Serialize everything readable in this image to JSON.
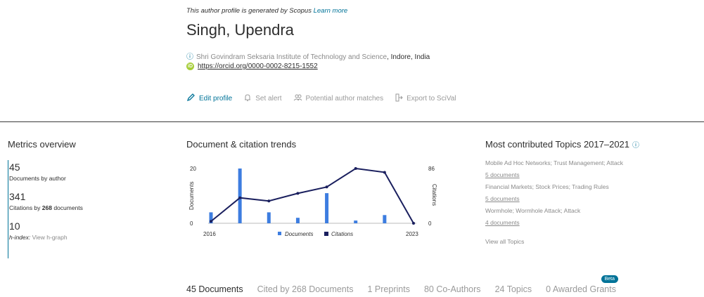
{
  "header": {
    "generated_text": "This author profile is generated by Scopus",
    "learn_more": "Learn more",
    "author_name": "Singh, Upendra",
    "institution": "Shri Govindram Seksaria Institute of Technology and Science",
    "location": ", Indore, India",
    "orcid_badge": "iD",
    "orcid_url": "https://orcid.org/0000-0002-8215-1552",
    "info_icon": "info-icon"
  },
  "actions": {
    "edit_profile": "Edit profile",
    "set_alert": "Set alert",
    "potential_matches": "Potential author matches",
    "export": "Export to SciVal"
  },
  "metrics": {
    "title": "Metrics overview",
    "documents_value": "45",
    "documents_label": "Documents by author",
    "citations_value": "341",
    "citations_label_pre": "Citations by ",
    "citations_docs": "268",
    "citations_label_post": " documents",
    "hindex_value": "10",
    "hindex_label": "h-index:",
    "hindex_link": "View h-graph"
  },
  "trends": {
    "title": "Document & citation trends"
  },
  "chart_data": {
    "type": "bar",
    "title": "Document & citation trends",
    "x": [
      2016,
      2017,
      2018,
      2019,
      2020,
      2021,
      2022,
      2023
    ],
    "x_tick_labels": [
      "2016",
      "2023"
    ],
    "ylabel_left": "Documents",
    "ylabel_right": "Citations",
    "ylim_left": [
      0,
      20
    ],
    "ylim_right": [
      0,
      86
    ],
    "left_ticks": [
      "20",
      "0"
    ],
    "right_ticks": [
      "86",
      "0"
    ],
    "series": [
      {
        "name": "Documents",
        "type": "bar",
        "axis": "left",
        "color": "#3d7de0",
        "values": [
          4,
          20,
          4,
          2,
          11,
          1,
          3,
          0
        ]
      },
      {
        "name": "Citations",
        "type": "line",
        "axis": "right",
        "color": "#1a1f5e",
        "values": [
          3,
          40,
          35,
          47,
          57,
          86,
          80,
          0
        ]
      }
    ],
    "legend_placement": "bottom"
  },
  "topics": {
    "title": "Most contributed Topics 2017–2021",
    "items": [
      {
        "name": "Mobile Ad Hoc Networks; Trust Management; Attack",
        "count": "5 documents"
      },
      {
        "name": "Financial Markets; Stock Prices; Trading Rules",
        "count": "5 documents"
      },
      {
        "name": "Wormhole; Wormhole Attack; Attack",
        "count": "4 documents"
      }
    ],
    "view_all": "View all Topics"
  },
  "tabs": {
    "documents": "45 Documents",
    "cited_by": "Cited by 268 Documents",
    "preprints": "1 Preprints",
    "coauthors": "80 Co-Authors",
    "topics": "24 Topics",
    "grants": "0 Awarded Grants",
    "beta": "Beta"
  }
}
